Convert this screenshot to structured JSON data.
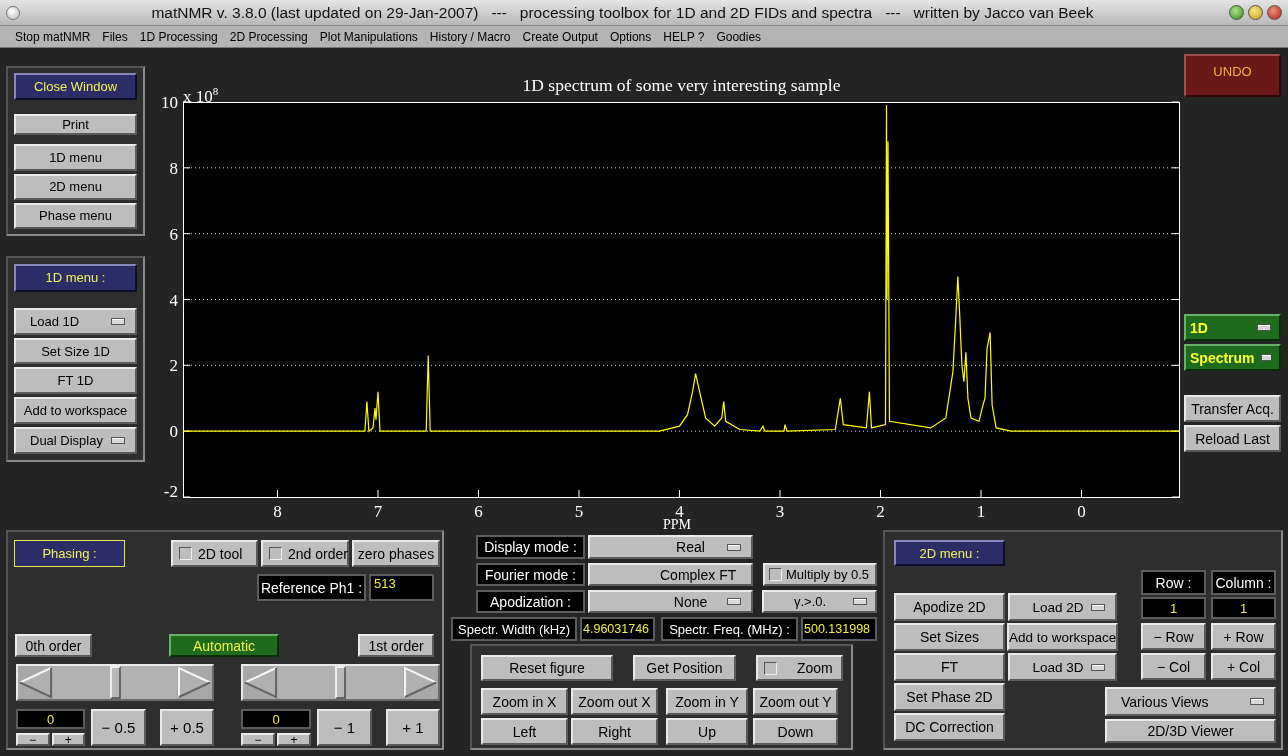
{
  "window": {
    "title": "matNMR v. 3.8.0 (last updated on 29-Jan-2007)   ---   processing toolbox for 1D and 2D FIDs and spectra   ---   written by Jacco van Beek"
  },
  "menu_bar": [
    "Stop matNMR",
    "Files",
    "1D Processing",
    "2D Processing",
    "Plot Manipulations",
    "History / Macro",
    "Create Output",
    "Options",
    "HELP ?",
    "Goodies"
  ],
  "main_panel": {
    "buttons": [
      {
        "label": "Close Window",
        "kind": "primary"
      },
      {
        "label": "Print",
        "kind": "button"
      },
      {
        "label": "1D menu",
        "kind": "button"
      },
      {
        "label": "2D menu",
        "kind": "button"
      },
      {
        "label": "Phase menu",
        "kind": "button"
      }
    ]
  },
  "menu_1d": {
    "title": "1D menu :",
    "buttons": [
      {
        "label": "Load 1D",
        "kind": "dropdown"
      },
      {
        "label": "Set Size 1D",
        "kind": "button"
      },
      {
        "label": "FT 1D",
        "kind": "button"
      },
      {
        "label": "Add to workspace",
        "kind": "button"
      },
      {
        "label": "Dual Display",
        "kind": "dropdown"
      }
    ]
  },
  "plot": {
    "multiplier": "x 10$^{8}$",
    "chart_data": {
      "type": "line",
      "grid": true,
      "title": "1D spectrum of some very interesting sample",
      "xlabel": "PPM",
      "xlim": [
        8.94,
        -0.97
      ],
      "ylim": [
        -2,
        10
      ],
      "xticks": [
        8,
        7,
        6,
        5,
        4,
        3,
        2,
        1,
        0
      ],
      "yticks": [
        -2,
        0,
        2,
        4,
        6,
        8,
        10
      ],
      "x": [
        8.94,
        7.13,
        7.11,
        7.09,
        7.05,
        7.03,
        7.02,
        7.0,
        6.98,
        6.52,
        6.5,
        6.48,
        4.2,
        4.0,
        3.92,
        3.87,
        3.84,
        3.8,
        3.74,
        3.65,
        3.58,
        3.56,
        3.54,
        3.4,
        3.2,
        3.17,
        3.15,
        2.96,
        2.95,
        2.93,
        2.45,
        2.4,
        2.37,
        2.14,
        2.11,
        2.09,
        1.95,
        1.94,
        1.935,
        1.925,
        1.91,
        1.5,
        1.35,
        1.28,
        1.25,
        1.23,
        1.21,
        1.19,
        1.17,
        1.15,
        1.13,
        1.1,
        1.02,
        0.98,
        0.96,
        0.94,
        0.91,
        0.89,
        0.85,
        0.7,
        -0.97
      ],
      "series": [
        {
          "color": "#ffff00",
          "values": [
            0,
            0,
            0.9,
            0,
            0.1,
            0.7,
            0.35,
            1.2,
            0,
            0,
            2.3,
            0,
            0,
            0.15,
            0.5,
            1.2,
            1.75,
            1.2,
            0.4,
            0.15,
            0.4,
            0.9,
            0.3,
            0.05,
            0,
            0.15,
            0,
            0,
            0.2,
            0,
            0.05,
            1.0,
            0.2,
            0.1,
            1.2,
            0.1,
            0.2,
            9.9,
            4,
            8.8,
            0.3,
            0.1,
            0.4,
            1.8,
            3.5,
            4.7,
            3.4,
            2.0,
            1.5,
            2.4,
            1.0,
            0.4,
            0.3,
            0.8,
            1.0,
            2.5,
            3.0,
            0.8,
            0.1,
            0,
            0
          ]
        }
      ]
    }
  },
  "right_panel": {
    "undo": "UNDO",
    "selectors": [
      {
        "label": "1D"
      },
      {
        "label": "Spectrum"
      }
    ],
    "buttons": [
      "Transfer Acq.",
      "Reload Last"
    ]
  },
  "phasing": {
    "title": "Phasing :",
    "toggles": [
      {
        "label": "2D tool",
        "checked": false
      },
      {
        "label": "2nd order",
        "checked": false
      }
    ],
    "zero_button": "zero phases",
    "reference": {
      "label": "Reference Ph1 :",
      "value": "513"
    },
    "zeroth_button": "0th order",
    "automatic": "Automatic",
    "first_button": "1st order",
    "controls": [
      {
        "level": 0.5,
        "value": "0",
        "minus": "−",
        "plus": "+",
        "step_down": "− 0.5",
        "step_up": "+ 0.5"
      },
      {
        "level": 0.5,
        "value": "0",
        "minus": "−",
        "plus": "+",
        "step_down": "− 1",
        "step_up": "+ 1"
      }
    ]
  },
  "settings": {
    "rows": [
      {
        "label": "Display mode :",
        "value": "Real"
      },
      {
        "label": "Fourier mode :",
        "value": "Complex FT",
        "extra": {
          "kind": "checkbox",
          "label": "Multiply by 0.5",
          "checked": false
        }
      },
      {
        "label": "Apodization :",
        "value": "None",
        "extra": {
          "kind": "dropdown",
          "label": "γ.>.0."
        }
      }
    ],
    "spectral_width": {
      "label": "Spectr. Width (kHz)",
      "value": "4.96031746"
    },
    "spectral_freq": {
      "label": "Spectr. Freq. (MHz) :",
      "value": "500.131998"
    }
  },
  "zoom_panel": {
    "reset": "Reset figure",
    "position": "Get Position",
    "zoom": {
      "label": "Zoom",
      "checked": false
    },
    "buttons": [
      "Zoom in X",
      "Zoom out X",
      "Zoom in Y",
      "Zoom out Y",
      "Left",
      "Right",
      "Up",
      "Down"
    ]
  },
  "menu_2d": {
    "title": "2D menu :",
    "column_1": [
      "Apodize 2D",
      "Set Sizes",
      "FT",
      "Set Phase 2D",
      "DC Correction"
    ],
    "column_2": [
      {
        "label": "Load 2D",
        "kind": "dropdown"
      },
      {
        "label": "Add to workspace",
        "kind": "button"
      },
      {
        "label": "Load 3D",
        "kind": "dropdown"
      }
    ],
    "row_label": "Row :",
    "column_label": "Column :",
    "row_value": "1",
    "column_value": "1",
    "row_buttons": [
      "− Row",
      "+ Row",
      "− Col",
      "+ Col"
    ],
    "views": "Various Views",
    "viewer": "2D/3D Viewer"
  }
}
